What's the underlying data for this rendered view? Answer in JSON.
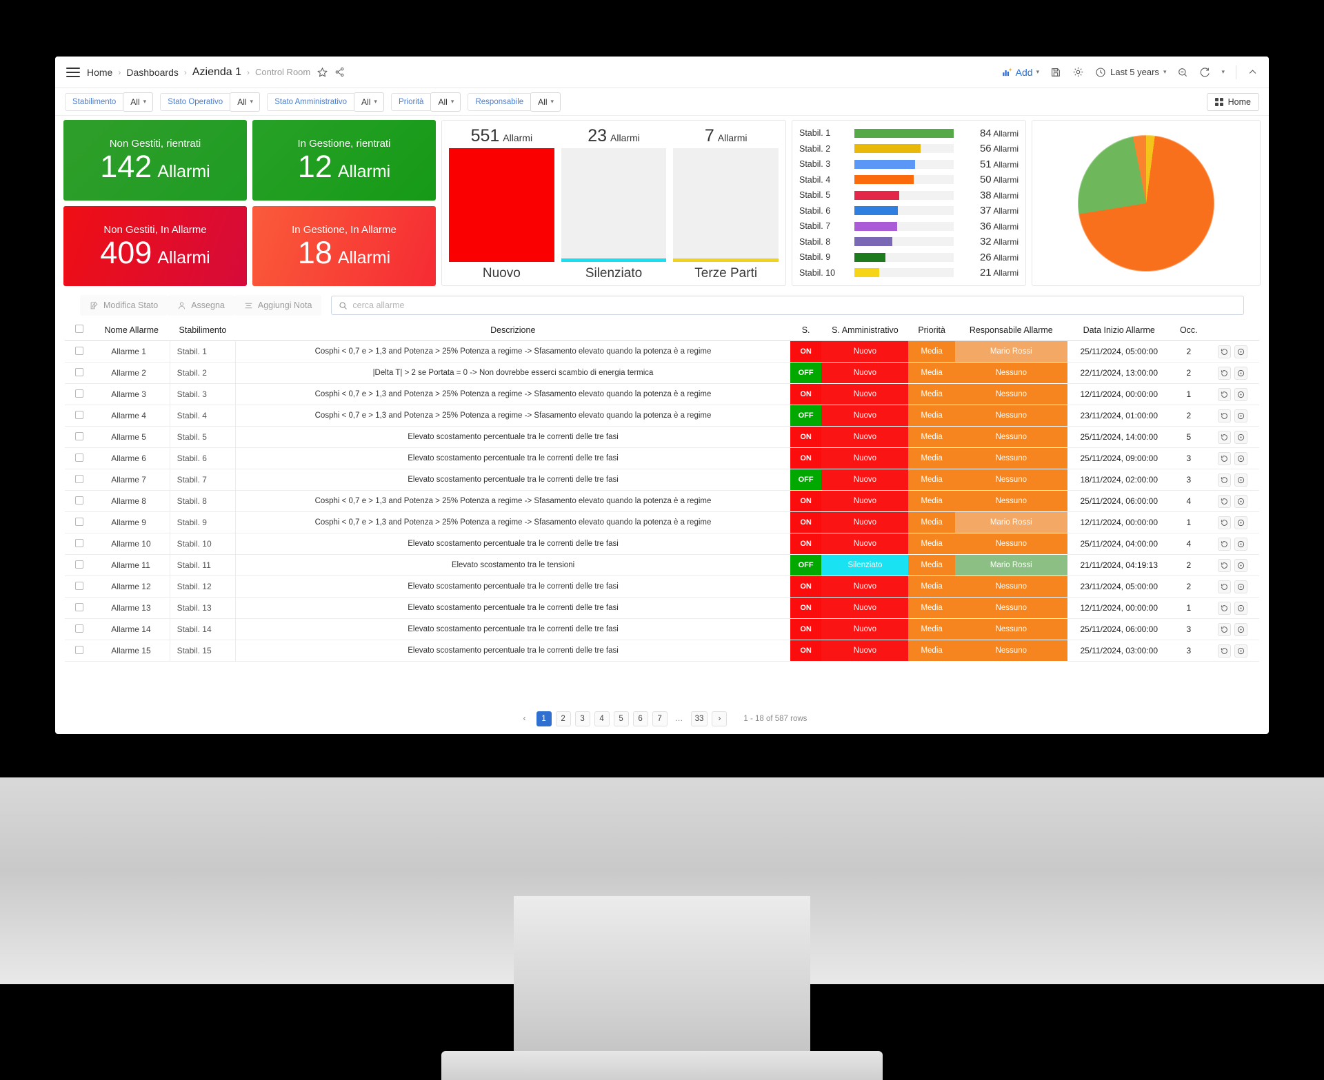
{
  "topbar": {
    "menu_icon": "hamburger-icon",
    "breadcrumb": [
      "Home",
      "Dashboards",
      "Azienda 1",
      "Control Room"
    ],
    "star_icon": "star-icon",
    "share_icon": "share-icon",
    "add_label": "Add",
    "save_icon": "save-icon",
    "settings_icon": "gear-icon",
    "time_window": "Last 5 years",
    "zoom_out_icon": "zoom-out-icon",
    "refresh_icon": "refresh-icon",
    "collapse_icon": "chevron-up-icon"
  },
  "filters": [
    {
      "label": "Stabilimento",
      "value": "All"
    },
    {
      "label": "Stato Operativo",
      "value": "All"
    },
    {
      "label": "Stato Amministrativo",
      "value": "All"
    },
    {
      "label": "Priorità",
      "value": "All"
    },
    {
      "label": "Responsabile",
      "value": "All"
    }
  ],
  "home_button": "Home",
  "kpis": [
    {
      "title": "Non Gestiti, rientrati",
      "value": "142",
      "unit": "Allarmi",
      "color": "#2aa22a"
    },
    {
      "title": "In Gestione, rientrati",
      "value": "12",
      "unit": "Allarmi",
      "color": "#21a021"
    },
    {
      "title": "Non Gestiti, In Allarme",
      "value": "409",
      "unit": "Allarmi",
      "color": "#e8111e"
    },
    {
      "title": "In Gestione, In Allarme",
      "value": "18",
      "unit": "Allarmi",
      "color": "#f84033"
    }
  ],
  "chart_data": [
    {
      "type": "bar",
      "title": "Allarmi per Stato Amministrativo",
      "categories": [
        "Nuovo",
        "Silenziato",
        "Terze Parti"
      ],
      "values": [
        551,
        23,
        7
      ],
      "unit": "Allarmi",
      "colors": [
        "#fb0000",
        "#18e0f0",
        "#f0d31e"
      ],
      "ylim": [
        0,
        560
      ],
      "grid": false
    },
    {
      "type": "bar",
      "orientation": "horizontal",
      "title": "Allarmi per Stabilimento",
      "categories": [
        "Stabil. 1",
        "Stabil. 2",
        "Stabil. 3",
        "Stabil. 4",
        "Stabil. 5",
        "Stabil. 6",
        "Stabil. 7",
        "Stabil. 8",
        "Stabil. 9",
        "Stabil. 10"
      ],
      "values": [
        84,
        56,
        51,
        50,
        38,
        37,
        36,
        32,
        26,
        21
      ],
      "unit": "Allarmi",
      "colors": [
        "#55aa47",
        "#e8b80a",
        "#5b97f5",
        "#fb6a0b",
        "#e32749",
        "#2f7fe0",
        "#a95cd6",
        "#7b68b5",
        "#1d7a1d",
        "#f5d516"
      ],
      "xlim": [
        0,
        84
      ],
      "grid": false
    },
    {
      "type": "pie",
      "title": "Ripartizione Allarmi",
      "labels": [
        "Non Gestiti, In Allarme",
        "Non Gestiti, rientrati",
        "In Gestione, In Allarme",
        "In Gestione, rientrati"
      ],
      "values": [
        409,
        142,
        18,
        12
      ],
      "colors": [
        "#f9701c",
        "#6eb85b",
        "#f9832e",
        "#f3c419"
      ],
      "legend": "none"
    }
  ],
  "toolbar": {
    "modifica_stato": "Modifica Stato",
    "assegna": "Assegna",
    "aggiungi_nota": "Aggiungi Nota",
    "search_placeholder": "cerca allarme",
    "search_value": ""
  },
  "table": {
    "columns": [
      "",
      "Nome Allarme",
      "Stabilimento",
      "Descrizione",
      "S.",
      "S. Amministrativo",
      "Priorità",
      "Responsabile Allarme",
      "Data Inizio Allarme",
      "Occ.",
      ""
    ],
    "desc_a": "Cosphi < 0,7 e > 1,3 and Potenza > 25% Potenza a regime -> Sfasamento elevato quando la potenza è a regime",
    "desc_b": "|Delta T| > 2 se Portata = 0 -> Non dovrebbe esserci scambio di energia termica",
    "desc_c": "Elevato scostamento percentuale tra le correnti delle tre fasi",
    "desc_d": "Elevato scostamento tra le tensioni",
    "rows": [
      {
        "nome": "Allarme 1",
        "stab": "Stabil. 1",
        "desc": "Cosphi < 0,7 e > 1,3 and Potenza > 25% Potenza a regime -> Sfasamento elevato quando la potenza è a regime",
        "s": "ON",
        "amm": "Nuovo",
        "pri": "Media",
        "resp": "Mario Rossi",
        "data": "25/11/2024, 05:00:00",
        "occ": "2"
      },
      {
        "nome": "Allarme 2",
        "stab": "Stabil. 2",
        "desc": "|Delta T| > 2 se Portata = 0 -> Non dovrebbe esserci scambio di energia termica",
        "s": "OFF",
        "amm": "Nuovo",
        "pri": "Media",
        "resp": "Nessuno",
        "data": "22/11/2024, 13:00:00",
        "occ": "2"
      },
      {
        "nome": "Allarme 3",
        "stab": "Stabil. 3",
        "desc": "Cosphi < 0,7 e > 1,3 and Potenza > 25% Potenza a regime -> Sfasamento elevato quando la potenza è a regime",
        "s": "ON",
        "amm": "Nuovo",
        "pri": "Media",
        "resp": "Nessuno",
        "data": "12/11/2024, 00:00:00",
        "occ": "1"
      },
      {
        "nome": "Allarme 4",
        "stab": "Stabil. 4",
        "desc": "Cosphi < 0,7 e > 1,3 and Potenza > 25% Potenza a regime -> Sfasamento elevato quando la potenza è a regime",
        "s": "OFF",
        "amm": "Nuovo",
        "pri": "Media",
        "resp": "Nessuno",
        "data": "23/11/2024, 01:00:00",
        "occ": "2"
      },
      {
        "nome": "Allarme 5",
        "stab": "Stabil. 5",
        "desc": "Elevato scostamento percentuale tra le correnti delle tre fasi",
        "s": "ON",
        "amm": "Nuovo",
        "pri": "Media",
        "resp": "Nessuno",
        "data": "25/11/2024, 14:00:00",
        "occ": "5"
      },
      {
        "nome": "Allarme 6",
        "stab": "Stabil. 6",
        "desc": "Elevato scostamento percentuale tra le correnti delle tre fasi",
        "s": "ON",
        "amm": "Nuovo",
        "pri": "Media",
        "resp": "Nessuno",
        "data": "25/11/2024, 09:00:00",
        "occ": "3"
      },
      {
        "nome": "Allarme 7",
        "stab": "Stabil. 7",
        "desc": "Elevato scostamento percentuale tra le correnti delle tre fasi",
        "s": "OFF",
        "amm": "Nuovo",
        "pri": "Media",
        "resp": "Nessuno",
        "data": "18/11/2024, 02:00:00",
        "occ": "3"
      },
      {
        "nome": "Allarme 8",
        "stab": "Stabil. 8",
        "desc": "Cosphi < 0,7 e > 1,3 and Potenza > 25% Potenza a regime -> Sfasamento elevato quando la potenza è a regime",
        "s": "ON",
        "amm": "Nuovo",
        "pri": "Media",
        "resp": "Nessuno",
        "data": "25/11/2024, 06:00:00",
        "occ": "4"
      },
      {
        "nome": "Allarme 9",
        "stab": "Stabil. 9",
        "desc": "Cosphi < 0,7 e > 1,3 and Potenza > 25% Potenza a regime -> Sfasamento elevato quando la potenza è a regime",
        "s": "ON",
        "amm": "Nuovo",
        "pri": "Media",
        "resp": "Mario Rossi",
        "data": "12/11/2024, 00:00:00",
        "occ": "1"
      },
      {
        "nome": "Allarme 10",
        "stab": "Stabil. 10",
        "desc": "Elevato scostamento percentuale tra le correnti delle tre fasi",
        "s": "ON",
        "amm": "Nuovo",
        "pri": "Media",
        "resp": "Nessuno",
        "data": "25/11/2024, 04:00:00",
        "occ": "4"
      },
      {
        "nome": "Allarme 11",
        "stab": "Stabil. 11",
        "desc": "Elevato scostamento tra le tensioni",
        "s": "OFF",
        "amm": "Silenziato",
        "pri": "Media",
        "resp": "Mario Rossi",
        "data": "21/11/2024, 04:19:13",
        "occ": "2"
      },
      {
        "nome": "Allarme 12",
        "stab": "Stabil. 12",
        "desc": "Elevato scostamento percentuale tra le correnti delle tre fasi",
        "s": "ON",
        "amm": "Nuovo",
        "pri": "Media",
        "resp": "Nessuno",
        "data": "23/11/2024, 05:00:00",
        "occ": "2"
      },
      {
        "nome": "Allarme 13",
        "stab": "Stabil. 13",
        "desc": "Elevato scostamento percentuale tra le correnti delle tre fasi",
        "s": "ON",
        "amm": "Nuovo",
        "pri": "Media",
        "resp": "Nessuno",
        "data": "12/11/2024, 00:00:00",
        "occ": "1"
      },
      {
        "nome": "Allarme 14",
        "stab": "Stabil. 14",
        "desc": "Elevato scostamento percentuale tra le correnti delle tre fasi",
        "s": "ON",
        "amm": "Nuovo",
        "pri": "Media",
        "resp": "Nessuno",
        "data": "25/11/2024, 06:00:00",
        "occ": "3"
      },
      {
        "nome": "Allarme 15",
        "stab": "Stabil. 15",
        "desc": "Elevato scostamento percentuale tra le correnti delle tre fasi",
        "s": "ON",
        "amm": "Nuovo",
        "pri": "Media",
        "resp": "Nessuno",
        "data": "25/11/2024, 03:00:00",
        "occ": "3"
      }
    ],
    "colors": {
      "on": "#00a800",
      "off": "#00a800",
      "on_bg": "#fb0d0d",
      "amm_nuovo": "#fb1414",
      "amm_silenziato": "#19e2f2",
      "pri_media": "#f7851f",
      "resp_nessuno": "#f7851f",
      "resp_assigned": "#f3a866",
      "resp_green": "#8cbf84"
    }
  },
  "pagination": {
    "prev": "‹",
    "pages": [
      "1",
      "2",
      "3",
      "4",
      "5",
      "6",
      "7",
      "…",
      "33"
    ],
    "active": "1",
    "next": "›",
    "info": "1 - 18 of 587 rows"
  }
}
